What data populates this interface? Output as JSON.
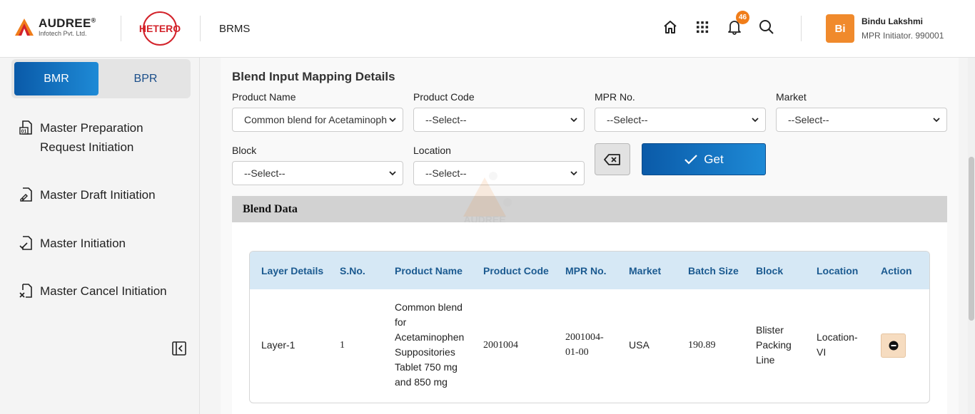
{
  "header": {
    "brand_name": "AUDREE",
    "brand_reg": "®",
    "brand_sub": "Infotech Pvt. Ltd.",
    "partner_logo": "HETERO",
    "app_title": "BRMS",
    "notification_count": "46",
    "user": {
      "initials": "Bi",
      "name": "Bindu Lakshmi",
      "role": "MPR Initiator. 990001"
    },
    "icons": [
      "home-icon",
      "apps-grid-icon",
      "bell-icon",
      "search-icon"
    ]
  },
  "sidebar": {
    "segments": {
      "bmr": "BMR",
      "bpr": "BPR"
    },
    "items": [
      {
        "label_line1": "Master Preparation",
        "label_line2": "Request Initiation",
        "icon": "document-01-icon"
      },
      {
        "label_line1": "Master Draft Initiation",
        "icon": "document-edit-icon"
      },
      {
        "label_line1": "Master Initiation",
        "icon": "document-check-icon"
      },
      {
        "label_line1": "Master Cancel Initiation",
        "icon": "document-cancel-icon"
      }
    ]
  },
  "form": {
    "title": "Blend Input Mapping Details",
    "product_name": {
      "label": "Product Name",
      "value": "Common blend for Acetaminoph"
    },
    "product_code": {
      "label": "Product Code",
      "value": "--Select--"
    },
    "mpr_no": {
      "label": "MPR No.",
      "value": "--Select--"
    },
    "market": {
      "label": "Market",
      "value": "--Select--"
    },
    "block": {
      "label": "Block",
      "value": "--Select--"
    },
    "location": {
      "label": "Location",
      "value": "--Select--"
    },
    "get_label": "Get"
  },
  "blend_data": {
    "title": "Blend Data",
    "columns": [
      "Layer Details",
      "S.No.",
      "Product Name",
      "Product Code",
      "MPR No.",
      "Market",
      "Batch Size",
      "Block",
      "Location",
      "Action"
    ],
    "rows": [
      {
        "layer": "Layer-1",
        "sno": "1",
        "product_name": [
          "Common blend",
          "for",
          "Acetaminophen",
          "Suppositories",
          "Tablet 750 mg",
          "and 850 mg"
        ],
        "product_code": "2001004",
        "mpr_no": [
          "2001004-",
          "01-00"
        ],
        "market": "USA",
        "batch_size": "190.89",
        "block": [
          "Blister",
          "Packing",
          "Line"
        ],
        "location": [
          "Location-",
          "VI"
        ]
      }
    ]
  },
  "watermark": "AUDREE",
  "colors": {
    "primary": "#0a5aa8",
    "accent": "#f07d1a",
    "hetero_red": "#d3222a"
  }
}
